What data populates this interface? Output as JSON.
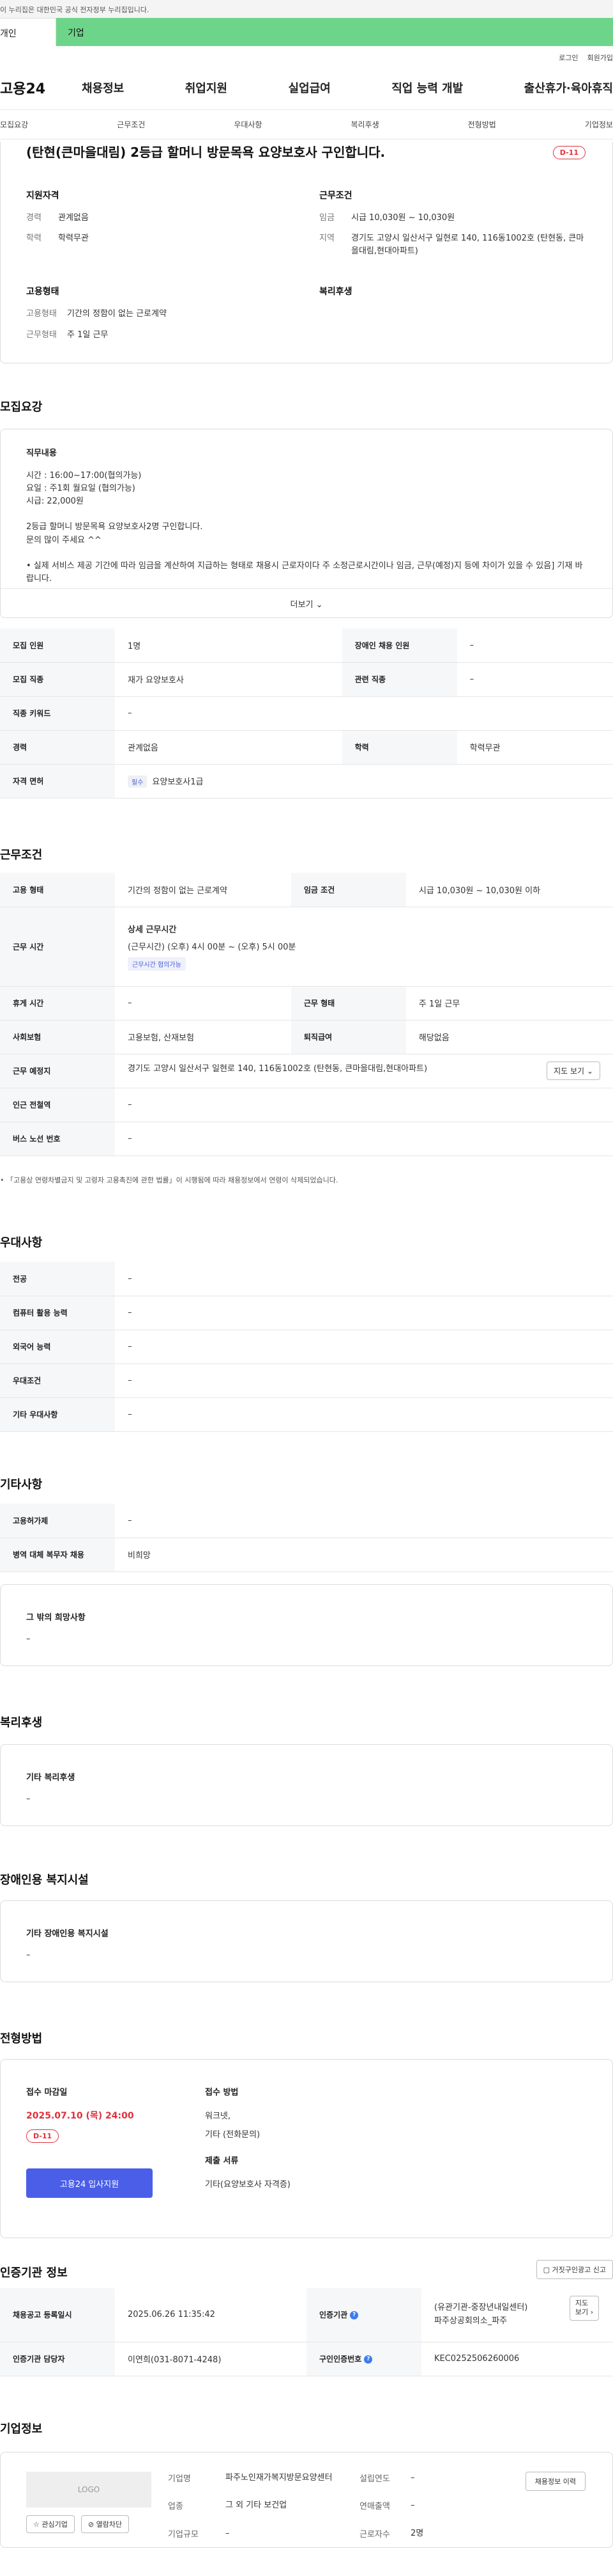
{
  "gov_banner": "이 누리집은 대한민국 공식 전자정부 누리집입니다.",
  "top_tabs": {
    "individual": "개인",
    "corporate": "기업"
  },
  "util_links": [
    "로그인",
    "회원가입"
  ],
  "brand": "고용24",
  "gnb": [
    "채용정보",
    "취업지원",
    "실업급여",
    "직업 능력 개발",
    "출산휴가·육아휴직"
  ],
  "subnav": [
    "모집요강",
    "근무조건",
    "우대사항",
    "복리후생",
    "전형방법",
    "기업정보"
  ],
  "header": {
    "title": "(탄현(큰마을대림) 2등급 할머니 방문목욕 요양보호사 구인합니다.",
    "dday": "D-11",
    "qual_title": "지원자격",
    "career_k": "경력",
    "career_v": "관계없음",
    "edu_k": "학력",
    "edu_v": "학력무관",
    "cond_title": "근무조건",
    "wage_k": "임금",
    "wage_v": "시급 10,030원 ~ 10,030원",
    "area_k": "지역",
    "area_v": "경기도 고양시 일산서구 일현로 140, 116동1002호 (탄현동, 큰마을대림,현대아파트)",
    "emp_title": "고용형태",
    "emp_k": "고용형태",
    "emp_v": "기간의 정함이 없는 근로계약",
    "work_k": "근무형태",
    "work_v": "주 1일 근무",
    "welfare_title": "복리후생"
  },
  "recruit": {
    "title": "모집요강",
    "duty_title": "직무내용",
    "duty_lines": [
      "시간 : 16:00~17:00(협의가능)",
      "요일 : 주1회 월요일 (협의가능)",
      "시급: 22,000원",
      "",
      "2등급 할머니 방문목욕 요양보호사2명 구인합니다.",
      "문의 많이 주세요 ^^",
      "",
      "• 실제 서비스 제공 기간에 따라 임금을 계산하여 지급하는 형태로 채용시 근로자이다 주 소정근로시간이나 임금, 근무(예정)지 등에 차이가 있을 수 있음] 기재 바랍니다."
    ],
    "more_label": "더보기",
    "rows": [
      {
        "k1": "모집 인원",
        "v1": "1명",
        "k2": "장애인 채용 인원",
        "v2": "–"
      },
      {
        "k1": "모집 직종",
        "v1": "재가 요양보호사",
        "k2": "관련 직종",
        "v2": "–"
      },
      {
        "k1": "직종 키워드",
        "v1": "–"
      },
      {
        "k1": "경력",
        "v1": "관계없음",
        "k2": "학력",
        "v2": "학력무관"
      }
    ],
    "license_k": "자격 면허",
    "license_badge": "필수",
    "license_v": "요양보호사1급"
  },
  "conditions": {
    "title": "근무조건",
    "emp_k": "고용 형태",
    "emp_v": "기간의 정함이 없는 근로계약",
    "wage_k": "임금 조건",
    "wage_v": "시급 10,030원 ~ 10,030원 이하",
    "time_k": "근무 시간",
    "time_detail_title": "상세 근무시간",
    "time_detail": "(근무시간) (오후) 4시 00분 ~ (오후) 5시 00분",
    "time_badge": "근무시간 협의가능",
    "rest_k": "휴게 시간",
    "rest_v": "–",
    "form_k": "근무 형태",
    "form_v": "주 1일 근무",
    "ins_k": "사회보험",
    "ins_v": "고용보험, 산재보험",
    "sev_k": "퇴직급여",
    "sev_v": "해당없음",
    "place_k": "근무 예정지",
    "place_v": "경기도 고양시 일산서구 일현로 140, 116동1002호 (탄현동, 큰마을대림,현대아파트)",
    "map_btn": "지도 보기",
    "subway_k": "인근 전철역",
    "subway_v": "–",
    "bus_k": "버스 노선 번호",
    "bus_v": "–",
    "note": "「고용상 연령차별금지 및 고령자 고용촉진에 관한 법률」이 시행됨에 따라 채용정보에서 연령이 삭제되었습니다."
  },
  "preference": {
    "title": "우대사항",
    "rows": [
      {
        "k": "전공",
        "v": "–"
      },
      {
        "k": "컴퓨터 활용 능력",
        "v": "–"
      },
      {
        "k": "외국어 능력",
        "v": "–"
      },
      {
        "k": "우대조건",
        "v": "–"
      },
      {
        "k": "기타 우대사항",
        "v": "–"
      }
    ]
  },
  "others": {
    "title": "기타사항",
    "rows": [
      {
        "k": "고용허가제",
        "v": "–"
      },
      {
        "k": "병역 대체 복무자 채용",
        "v": "비희망"
      }
    ],
    "extra_title": "그 밖의 희망사항",
    "extra_v": "–"
  },
  "welfare": {
    "title": "복리후생",
    "sub_title": "기타 복리후생",
    "v": "–"
  },
  "disability": {
    "title": "장애인용 복지시설",
    "sub_title": "기타 장애인용 복지시설",
    "v": "–"
  },
  "selection": {
    "title": "전형방법",
    "deadline_title": "접수 마감일",
    "deadline": "2025.07.10 (목) 24:00",
    "dday": "D-11",
    "apply_btn": "고용24 입사지원",
    "method_title": "접수 방법",
    "method_lines": [
      "워크넷,",
      "기타 (전화문의)"
    ],
    "docs_title": "제출 서류",
    "docs_v": "기타(요양보호사 자격증)"
  },
  "agency": {
    "title": "인증기관 정보",
    "report_btn": "거짓구인광고 신고",
    "reg_k": "채용공고 등록일시",
    "reg_v": "2025.06.26 11:35:42",
    "org_k": "인증기관",
    "org_v1": "(유관기관-중장년내일센터)",
    "org_v2": "파주상공회의소_파주",
    "map_line1": "지도",
    "map_line2": "보기",
    "contact_k": "인증기관 담당자",
    "contact_v": "이연희(031-8071-4248)",
    "id_k": "구인인증번호",
    "id_v": "KEC0252506260006"
  },
  "corp": {
    "title": "기업정보",
    "logo": "LOGO",
    "fav_btn": "관심기업",
    "block_btn": "열람차단",
    "name_k": "기업명",
    "name_v": "파주노인재가복지방문요양센터",
    "industry_k": "업종",
    "industry_v": "그 외 기타 보건업",
    "size_k": "기업규모",
    "size_v": "–",
    "year_k": "설립연도",
    "year_v": "–",
    "sales_k": "연매출액",
    "sales_v": "–",
    "staff_k": "근로자수",
    "staff_v": "2명",
    "history_btn": "채용정보 이력"
  }
}
